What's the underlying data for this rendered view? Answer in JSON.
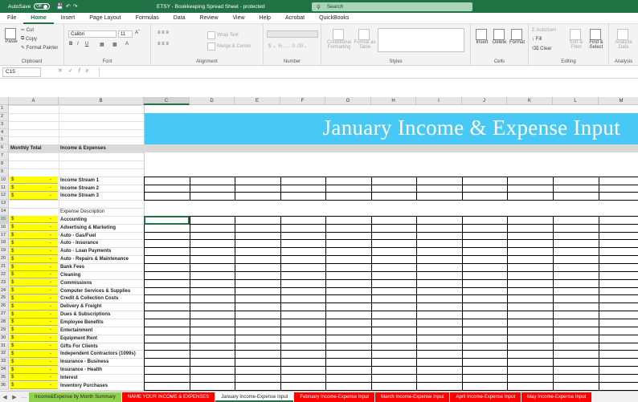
{
  "titlebar": {
    "autosave_label": "AutoSave",
    "autosave_state": "Off",
    "document_title": "ETSY - Bookkeeping Spread Sheet - protected",
    "search_placeholder": "Search"
  },
  "menu": [
    "File",
    "Home",
    "Insert",
    "Page Layout",
    "Formulas",
    "Data",
    "Review",
    "View",
    "Help",
    "Acrobat",
    "QuickBooks"
  ],
  "menu_active": "Home",
  "ribbon": {
    "clipboard": {
      "label": "Clipboard",
      "paste": "Paste",
      "cut": "Cut",
      "copy": "Copy",
      "format_painter": "Format Painter"
    },
    "font": {
      "label": "Font",
      "font_name": "Calibri",
      "font_size": "11"
    },
    "alignment": {
      "label": "Alignment",
      "wrap_text": "Wrap Text",
      "merge_center": "Merge & Center"
    },
    "number": {
      "label": "Number"
    },
    "styles": {
      "label": "Styles",
      "conditional": "Conditional Formatting",
      "format_table": "Format as Table"
    },
    "cells": {
      "label": "Cells",
      "insert": "Insert",
      "delete": "Delete",
      "format": "Format"
    },
    "editing": {
      "label": "Editing",
      "autosum": "AutoSum",
      "fill": "Fill",
      "clear": "Clear",
      "sort_filter": "Sort & Filter",
      "find_select": "Find & Select"
    },
    "analysis": {
      "label": "Analysis",
      "analyze_data": "Analyze Data"
    }
  },
  "formula_bar": {
    "name_box": "C15",
    "formula": ""
  },
  "columns": [
    "A",
    "B",
    "C",
    "D",
    "E",
    "F",
    "G",
    "H",
    "I",
    "J",
    "K",
    "L",
    "M"
  ],
  "selected_column": "C",
  "selected_row": "15",
  "rows": [
    "1",
    "2",
    "3",
    "4",
    "5",
    "6",
    "7",
    "8",
    "9",
    "10",
    "11",
    "12",
    "13",
    "14",
    "15",
    "16",
    "17",
    "18",
    "19",
    "20",
    "21",
    "22",
    "23",
    "24",
    "25",
    "26",
    "27",
    "28",
    "29",
    "30",
    "31",
    "32",
    "33",
    "34",
    "35",
    "36"
  ],
  "sheet": {
    "title": "January Income & Expense Input",
    "header_a": "Monthly Total",
    "header_b": "Income & Expenses",
    "currency": "$",
    "dash": "-",
    "income_streams": [
      "Income Stream 1",
      "Income Stream 2",
      "Income Stream 3"
    ],
    "expense_heading": "Expense Description",
    "expenses": [
      "Accounting",
      "Advertising & Marketing",
      "Auto - Gas/Fuel",
      "Auto - Insurance",
      "Auto - Loan Payments",
      "Auto - Repairs & Maintenance",
      "Bank Fees",
      "Cleaning",
      "Commissions",
      "Computer Services & Supplies",
      "Credit & Collection Costs",
      "Delivery & Freight",
      "Dues & Subscriptions",
      "Employee Benefits",
      "Entertainment",
      "Equipment Rent",
      "Gifts For Clients",
      "Independent Contractors (1099s)",
      "Insurance - Business",
      "Insurance - Health",
      "Interest",
      "Inventory Purchases"
    ]
  },
  "sheet_tabs": [
    {
      "label": "Income&Expense by Month Summary",
      "color": "#92d050"
    },
    {
      "label": "NAME YOUR INCOME & EXPENSES",
      "color": "#ff0000"
    },
    {
      "label": "January Income-Expense Input",
      "color": "#ffffff",
      "active": true
    },
    {
      "label": "February Income-Expense Input",
      "color": "#ff0000"
    },
    {
      "label": "March Income-Expense Input",
      "color": "#ff0000"
    },
    {
      "label": "April Income-Expense Input",
      "color": "#ff0000"
    },
    {
      "label": "May Income-Expense Input",
      "color": "#ff0000"
    }
  ],
  "colors": {
    "accent": "#217346",
    "banner": "#47c8f5",
    "highlight": "#ffff00"
  }
}
